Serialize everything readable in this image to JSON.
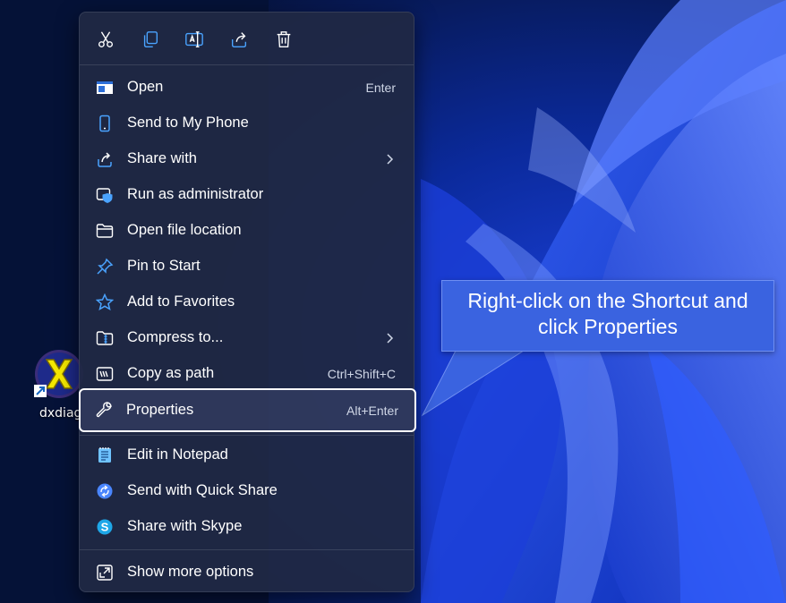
{
  "desktop": {
    "shortcut_label": "dxdiag"
  },
  "toolbar": {
    "buttons": [
      {
        "name": "cut",
        "icon": "scissors-icon"
      },
      {
        "name": "copy",
        "icon": "copy-icon"
      },
      {
        "name": "rename",
        "icon": "rename-icon"
      },
      {
        "name": "share",
        "icon": "share-icon"
      },
      {
        "name": "delete",
        "icon": "trash-icon"
      }
    ]
  },
  "menu": {
    "items": [
      {
        "label": "Open",
        "shortcut": "Enter",
        "icon": "window-icon"
      },
      {
        "label": "Send to My Phone",
        "shortcut": "",
        "icon": "phone-icon"
      },
      {
        "label": "Share with",
        "shortcut": "",
        "icon": "share-icon",
        "submenu": true
      },
      {
        "label": "Run as administrator",
        "shortcut": "",
        "icon": "shield-icon"
      },
      {
        "label": "Open file location",
        "shortcut": "",
        "icon": "folder-icon"
      },
      {
        "label": "Pin to Start",
        "shortcut": "",
        "icon": "pin-icon"
      },
      {
        "label": "Add to Favorites",
        "shortcut": "",
        "icon": "star-icon"
      },
      {
        "label": "Compress to...",
        "shortcut": "",
        "icon": "zip-folder-icon",
        "submenu": true
      },
      {
        "label": "Copy as path",
        "shortcut": "Ctrl+Shift+C",
        "icon": "path-icon"
      },
      {
        "label": "Properties",
        "shortcut": "Alt+Enter",
        "icon": "wrench-icon",
        "highlighted": true
      },
      {
        "label": "Edit in Notepad",
        "shortcut": "",
        "icon": "notepad-icon"
      },
      {
        "label": "Send with Quick Share",
        "shortcut": "",
        "icon": "quick-share-icon"
      },
      {
        "label": "Share with Skype",
        "shortcut": "",
        "icon": "skype-icon"
      },
      {
        "label": "Show more options",
        "shortcut": "",
        "icon": "expand-icon"
      }
    ]
  },
  "callout": {
    "line1": "Right-click on the Shortcut and",
    "line2": "click Properties"
  },
  "colors": {
    "menu_bg": "#202844",
    "accent": "#4aa3ff",
    "callout_bg": "#3a63e0",
    "highlight_outline": "#ffffff"
  }
}
